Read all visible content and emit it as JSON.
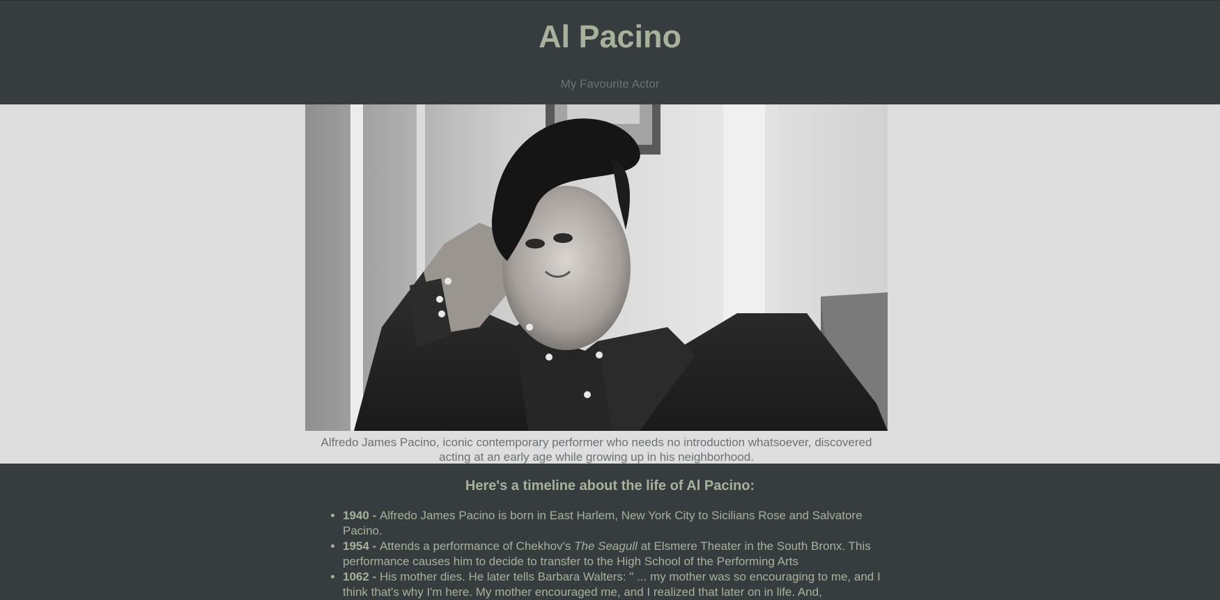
{
  "header": {
    "title": "Al Pacino",
    "subtitle": "My Favourite Actor"
  },
  "photo": {
    "caption": "Alfredo James Pacino, iconic contemporary performer who needs no introduction whatsoever, discovered acting at an early age while growing up in his neighborhood."
  },
  "timeline": {
    "heading": "Here's a timeline about the life of Al Pacino:",
    "items": [
      {
        "year": "1940",
        "separator": " - ",
        "text": "Alfredo James Pacino is born in East Harlem, New York City to Sicilians Rose and Salvatore Pacino."
      },
      {
        "year": "1954",
        "separator": " - ",
        "text_before": "Attends a performance of Chekhov's ",
        "emphasis": "The Seagull",
        "text_after": " at Elsmere Theater in the South Bronx. This performance causes him to decide to transfer to the High School of the Performing Arts"
      },
      {
        "year": "1062",
        "separator": " - ",
        "text": "His mother dies. He later tells Barbara Walters: \" ... my mother was so encouraging to me, and I think that's why I'm here. My mother encouraged me, and I realized that later on in life. And,"
      }
    ]
  },
  "colors": {
    "dark_bg": "#373c3f",
    "light_bg": "#dedede",
    "accent_text": "#a8b29b",
    "muted_text": "#6b7174"
  }
}
